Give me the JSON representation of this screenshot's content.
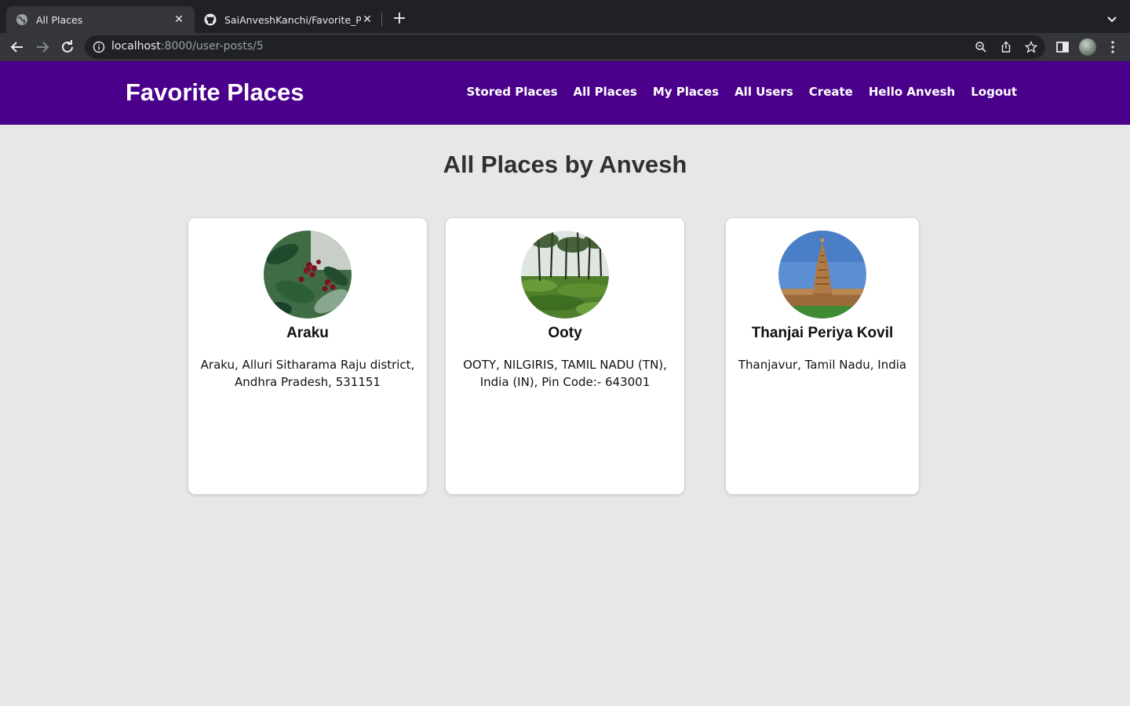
{
  "browser": {
    "tabs": [
      {
        "title": "All Places",
        "icon": "globe-icon",
        "active": true
      },
      {
        "title": "SaiAnveshKanchi/Favorite_Plac",
        "icon": "github-icon",
        "active": false
      }
    ],
    "url_host": "localhost",
    "url_path": ":8000/user-posts/5"
  },
  "header": {
    "brand": "Favorite Places",
    "nav": [
      "Stored Places",
      "All Places",
      "My Places",
      "All Users",
      "Create",
      "Hello Anvesh",
      "Logout"
    ]
  },
  "page": {
    "title": "All Places by Anvesh",
    "places": [
      {
        "name": "Araku",
        "address": "Araku, Alluri Sitharama Raju district, Andhra Pradesh, 531151",
        "image": "coffee-plant-photo"
      },
      {
        "name": "Ooty",
        "address": "OOTY, NILGIRIS, TAMIL NADU (TN), India (IN), Pin Code:- 643001",
        "image": "tea-garden-photo"
      },
      {
        "name": "Thanjai Periya Kovil",
        "address": "Thanjavur, Tamil Nadu, India",
        "image": "temple-photo"
      }
    ]
  },
  "colors": {
    "header_bg": "#4a008a",
    "page_bg": "#e7e7e7"
  }
}
